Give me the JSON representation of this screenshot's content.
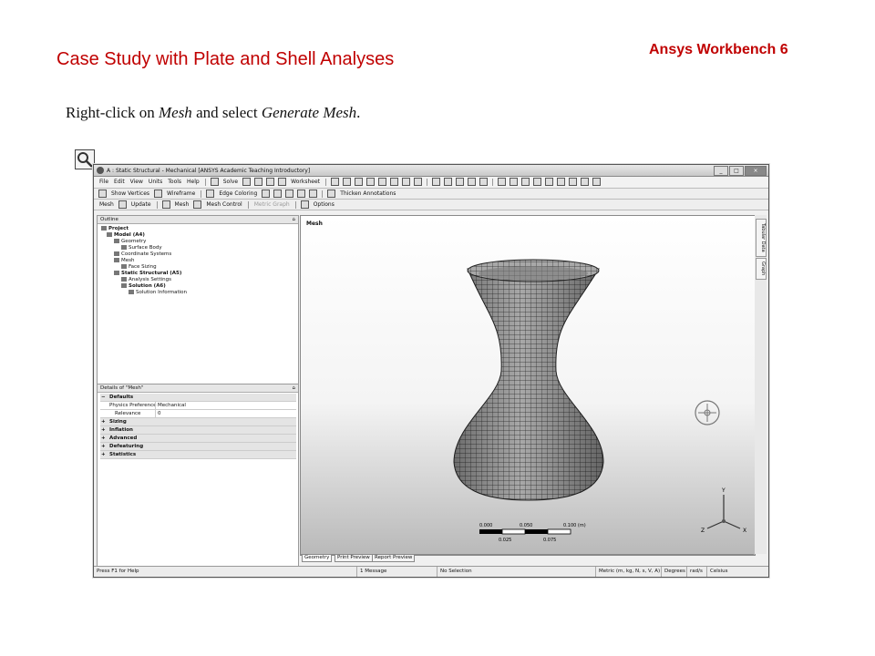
{
  "slide": {
    "title": "Case Study with Plate and Shell Analyses",
    "brand": "Ansys Workbench 6",
    "instruction": {
      "p1": "Right-click on ",
      "em1": "Mesh",
      "p2": " and select ",
      "em2": "Generate Mesh",
      "p3": "."
    }
  },
  "window": {
    "title": "A : Static Structural - Mechanical [ANSYS Academic Teaching Introductory]",
    "menu": [
      "File",
      "Edit",
      "View",
      "Units",
      "Tools",
      "Help"
    ],
    "toolbar1": {
      "solve": "Solve",
      "worksheet": "Worksheet"
    },
    "toolbar2": {
      "show_vertices": "Show Vertices",
      "wireframe": "Wireframe",
      "edge_coloring": "Edge Coloring",
      "thicken": "Thicken Annotations"
    },
    "toolbar3": {
      "mesh": "Mesh",
      "update": "Update",
      "mesh_menu": "Mesh",
      "mesh_control": "Mesh Control",
      "metric_graph": "Metric Graph",
      "options": "Options"
    },
    "outline": {
      "header": "Outline",
      "pin": "⌂",
      "tree": [
        {
          "label": "Project",
          "bold": true
        },
        {
          "label": "Model (A4)",
          "bold": true
        },
        {
          "label": "Geometry",
          "bold": false
        },
        {
          "label": "Surface Body",
          "bold": false
        },
        {
          "label": "Coordinate Systems",
          "bold": false
        },
        {
          "label": "Mesh",
          "bold": false
        },
        {
          "label": "Face Sizing",
          "bold": false
        },
        {
          "label": "Static Structural (A5)",
          "bold": true
        },
        {
          "label": "Analysis Settings",
          "bold": false
        },
        {
          "label": "Solution (A6)",
          "bold": true
        },
        {
          "label": "Solution Information",
          "bold": false
        }
      ]
    },
    "details": {
      "header": "Details of \"Mesh\"",
      "pin": "⌂",
      "rows": [
        {
          "k": "Defaults",
          "v": "",
          "group": true,
          "pm": "−"
        },
        {
          "k": "Physics Preference",
          "v": "Mechanical",
          "group": false,
          "pm": ""
        },
        {
          "k": "Relevance",
          "v": "0",
          "group": false,
          "pm": ""
        },
        {
          "k": "Sizing",
          "v": "",
          "group": true,
          "pm": "+"
        },
        {
          "k": "Inflation",
          "v": "",
          "group": true,
          "pm": "+"
        },
        {
          "k": "Advanced",
          "v": "",
          "group": true,
          "pm": "+"
        },
        {
          "k": "Defeaturing",
          "v": "",
          "group": true,
          "pm": "+"
        },
        {
          "k": "Statistics",
          "v": "",
          "group": true,
          "pm": "+"
        }
      ]
    },
    "graphics": {
      "title": "Mesh",
      "scale": {
        "t0": "0.000",
        "t1": "0.050",
        "t2": "0.100 (m)",
        "b1": "0.025",
        "b2": "0.075"
      },
      "axes": {
        "y": "Y",
        "x": "X",
        "z": "Z"
      }
    },
    "side_tabs": [
      "Tabular Data",
      "Graph"
    ],
    "bottom_tabs": [
      "Geometry",
      "Print Preview",
      "Report Preview"
    ],
    "status": {
      "help": "Press F1 for Help",
      "messages": "1 Message",
      "selection": "No Selection",
      "units": "Metric (m, kg, N, s, V, A)",
      "angle": "Degrees",
      "rate": "rad/s",
      "temp": "Celsius"
    }
  }
}
